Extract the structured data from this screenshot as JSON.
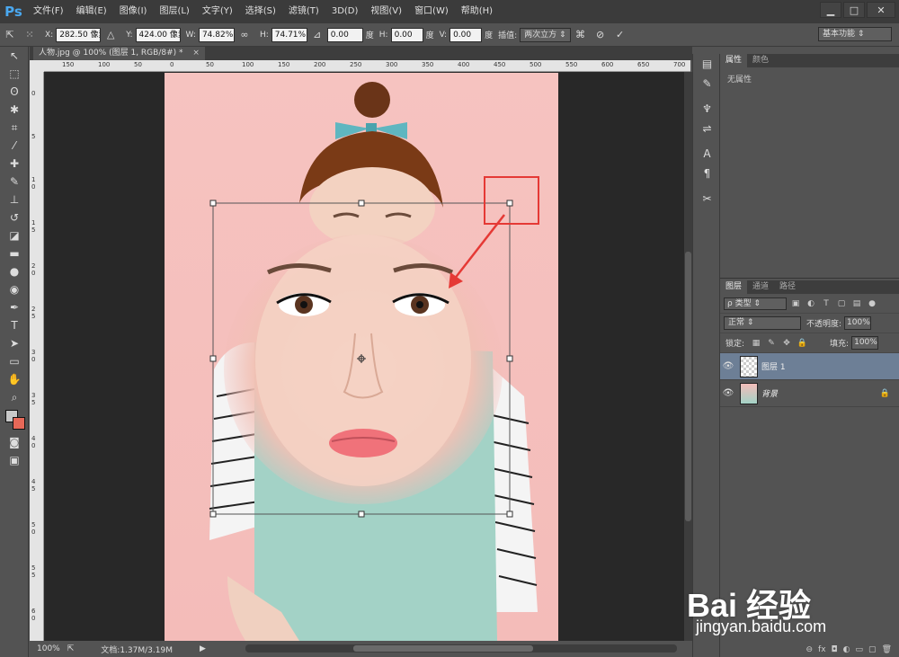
{
  "app": {
    "logo": "Ps"
  },
  "menu": [
    "文件(F)",
    "编辑(E)",
    "图像(I)",
    "图层(L)",
    "文字(Y)",
    "选择(S)",
    "滤镜(T)",
    "3D(D)",
    "视图(V)",
    "窗口(W)",
    "帮助(H)"
  ],
  "window_controls": {
    "minimize": "▁",
    "maximize": "□",
    "close": "✕"
  },
  "options": {
    "x_label": "X:",
    "x_value": "282.50 像素",
    "delta": "△",
    "y_label": "Y:",
    "y_value": "424.00 像素",
    "w_label": "W:",
    "w_value": "74.82%",
    "link": "∞",
    "h_label": "H:",
    "h_value": "74.71%",
    "angle_icon": "⊿",
    "angle_value": "0.00",
    "angle_unit": "度",
    "hskew_label": "H:",
    "hskew_value": "0.00",
    "hskew_unit": "度",
    "vskew_label": "V:",
    "vskew_value": "0.00",
    "vskew_unit": "度",
    "interp_label": "插值:",
    "interp_value": "两次立方 ⇕",
    "cancel_icon": "⊘",
    "commit_icon": "✓"
  },
  "workspace": "基本功能 ⇕",
  "document": {
    "tab_title": "人物.jpg @ 100% (图层 1, RGB/8#) *",
    "close": "×"
  },
  "hruler_labels": [
    "150",
    "100",
    "50",
    "0",
    "50",
    "100",
    "150",
    "200",
    "250",
    "300",
    "350",
    "400",
    "450",
    "500",
    "550",
    "600",
    "650",
    "700"
  ],
  "vruler_labels": [
    "0",
    "5",
    "1 0",
    "1 5",
    "2 0",
    "2 5",
    "3 0",
    "3 5",
    "4 0",
    "4 5",
    "5 0",
    "5 5",
    "6 0"
  ],
  "status": {
    "zoom": "100%",
    "doc_size": "文档:1.37M/3.19M",
    "play": "▶"
  },
  "properties": {
    "tabs": [
      "属性",
      "颜色"
    ],
    "empty_text": "无属性"
  },
  "layers": {
    "tabs": [
      "图层",
      "通道",
      "路径"
    ],
    "filter": "ρ 类型 ⇕",
    "blend_mode": "正常 ⇕",
    "opacity_label": "不透明度:",
    "opacity_value": "100%",
    "lock_label": "锁定:",
    "fill_label": "填充:",
    "fill_value": "100%",
    "items": [
      {
        "name": "图层 1",
        "visible": "👁",
        "selected": true
      },
      {
        "name": "背景",
        "visible": "👁",
        "lock": "🔒"
      }
    ]
  },
  "watermark": {
    "text": "Bai 经验",
    "url": "jingyan.baidu.com"
  }
}
